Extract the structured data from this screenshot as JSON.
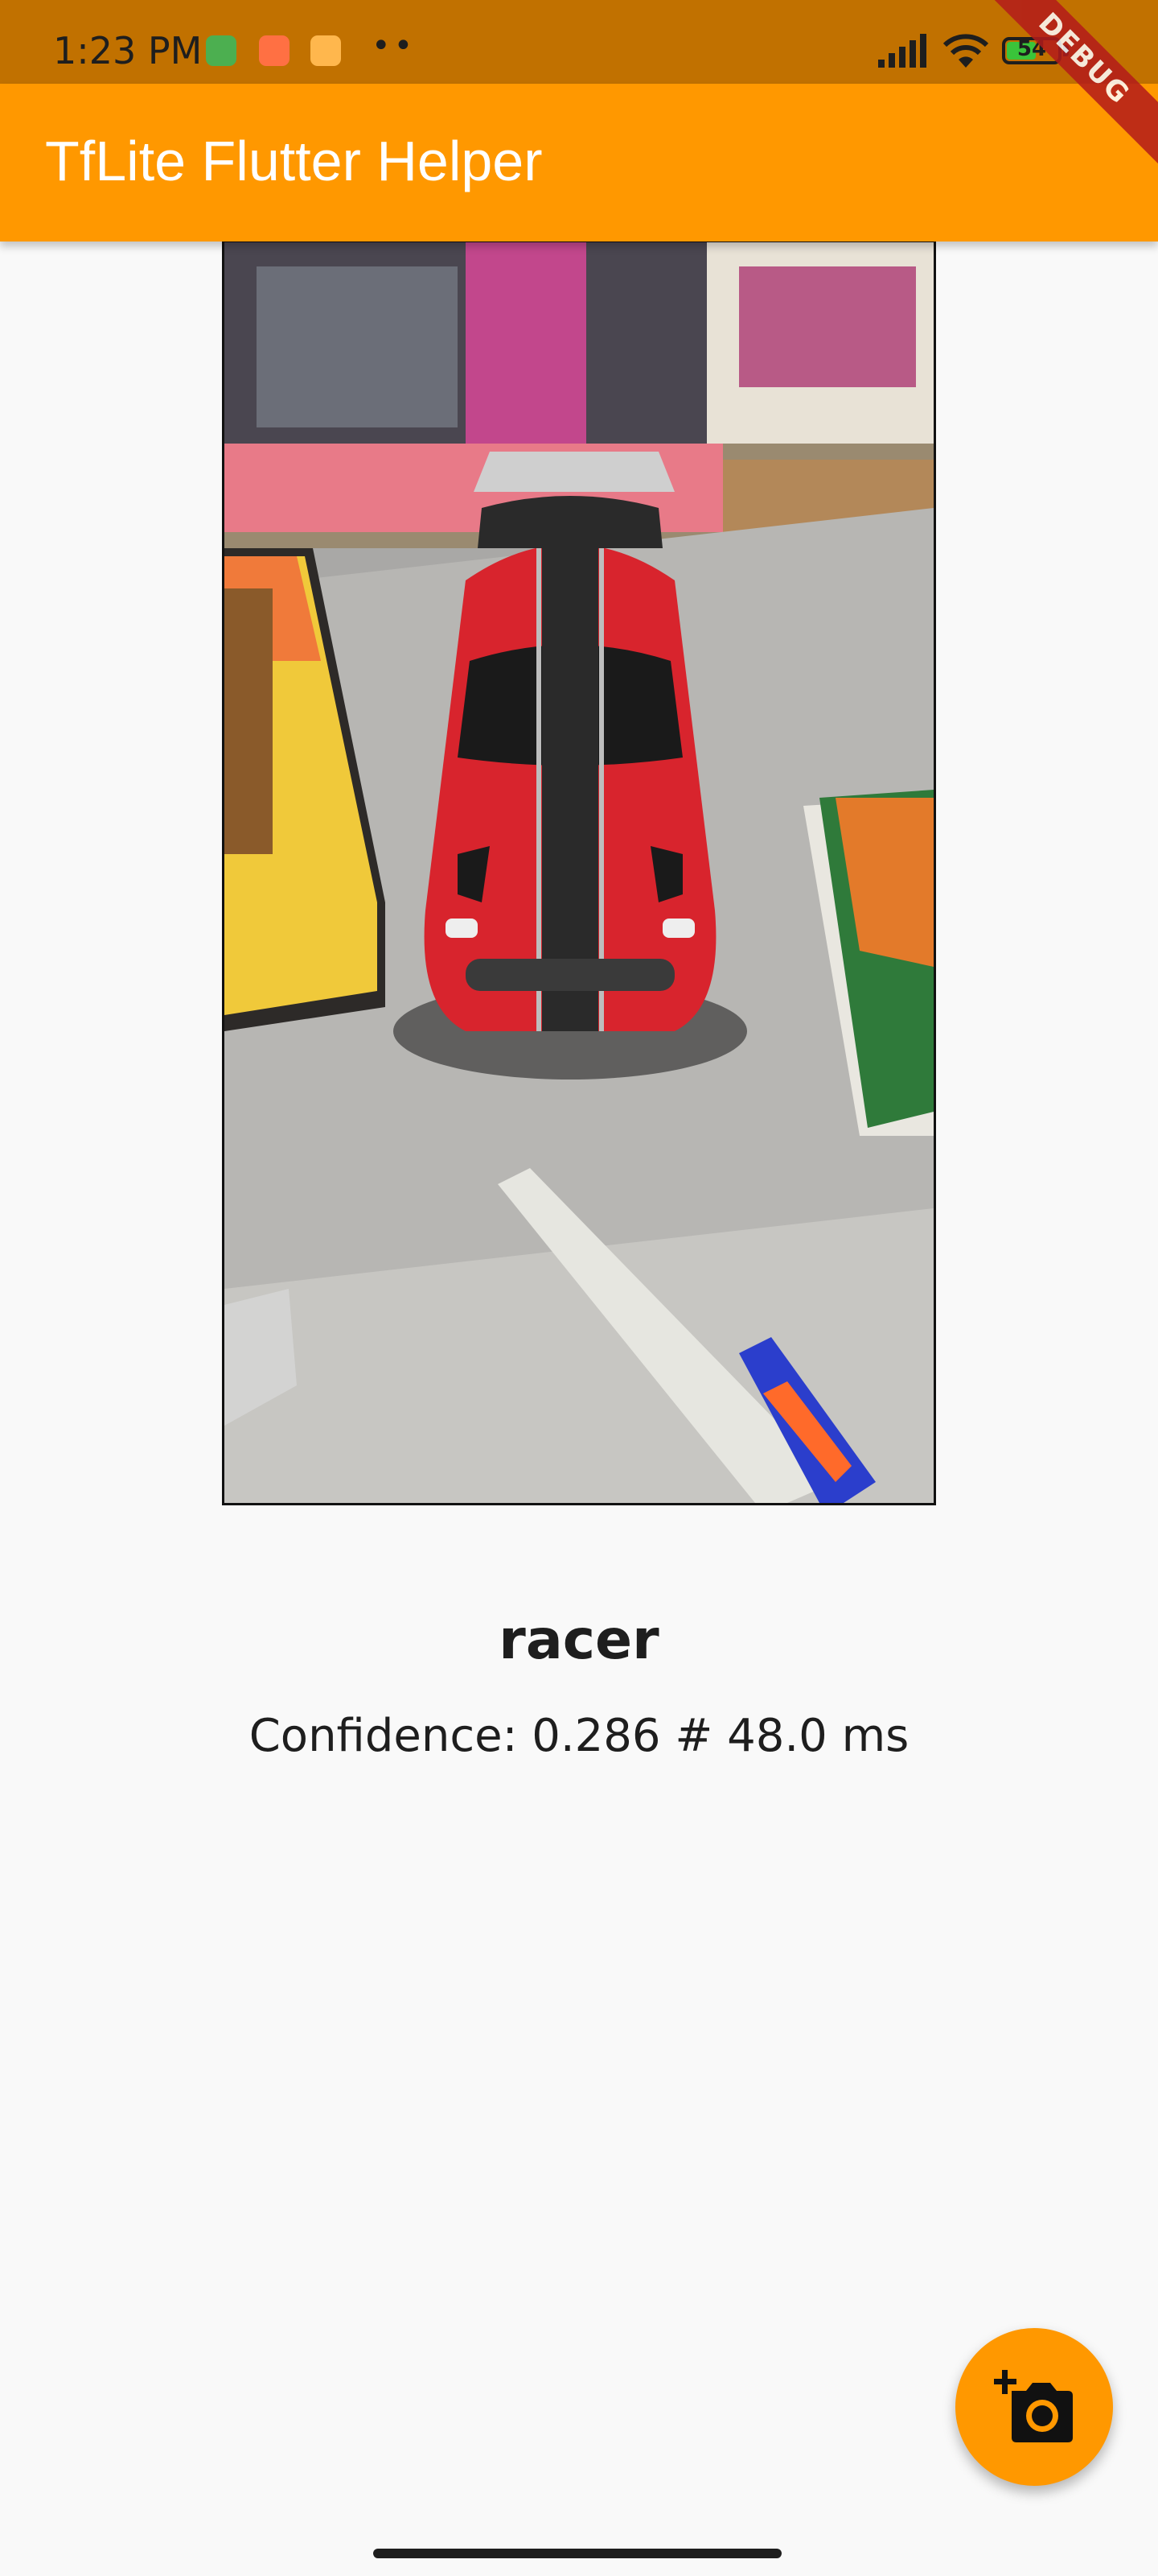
{
  "status_bar": {
    "time": "1:23 PM",
    "more": "••",
    "battery_level": "54",
    "icons": [
      "notification-app-green-icon",
      "notification-app-orange-icon",
      "notification-app-yellow-icon",
      "signal-icon",
      "wifi-icon",
      "battery-icon"
    ]
  },
  "debug_banner": "DEBUG",
  "app_bar": {
    "title": "TfLite Flutter Helper"
  },
  "result": {
    "label": "racer",
    "detail": "Confidence: 0.286 # 48.0 ms"
  },
  "fab": {
    "icon": "add-a-photo-icon"
  },
  "colors": {
    "accent": "#ff9800",
    "status_bar": "#c17100"
  }
}
